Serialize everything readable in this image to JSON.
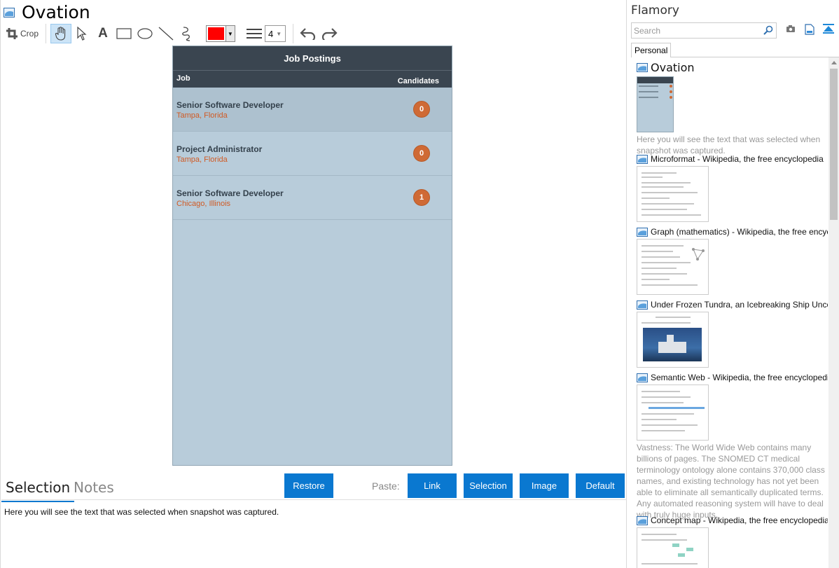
{
  "app": {
    "title": "Ovation"
  },
  "toolbar": {
    "crop_label": "Crop",
    "line_width": "4",
    "color": "#ff0000"
  },
  "snapshot": {
    "header": "Job Postings",
    "col_job": "Job",
    "col_candidates": "Candidates",
    "rows": [
      {
        "title": "Senior Software Developer",
        "location": "Tampa, Florida",
        "count": "0"
      },
      {
        "title": "Project Administrator",
        "location": "Tampa, Florida",
        "count": "0"
      },
      {
        "title": "Senior Software Developer",
        "location": "Chicago, Illinois",
        "count": "1"
      }
    ]
  },
  "bottom": {
    "tab_selection": "Selection",
    "tab_notes": "Notes",
    "restore": "Restore",
    "paste_label": "Paste:",
    "paste_link": "Link",
    "paste_selection": "Selection",
    "paste_image": "Image",
    "paste_default": "Default",
    "selection_text": "Here you will see the text that was selected when snapshot was captured."
  },
  "side": {
    "title": "Flamory",
    "search_placeholder": "Search",
    "tab": "Personal",
    "entries": [
      {
        "title": "Ovation",
        "desc": "Here you will see the text that was selected when snapshot was captured."
      },
      {
        "title": "Microformat - Wikipedia, the free encyclopedia"
      },
      {
        "title": "Graph (mathematics) - Wikipedia, the free encyclopedia"
      },
      {
        "title": "Under Frozen Tundra, an Icebreaking Ship Uncovers..."
      },
      {
        "title": "Semantic Web - Wikipedia, the free encyclopedia",
        "desc": "Vastness: The World Wide Web contains many billions of pages. The SNOMED CT medical terminology ontology alone contains 370,000 class names, and existing technology has not yet been able to eliminate all semantically duplicated terms. Any automated reasoning system will have to deal with truly huge inputs."
      },
      {
        "title": "Concept map - Wikipedia, the free encyclopedia"
      }
    ]
  },
  "colors": {
    "accent": "#0a78d0",
    "header_dark": "#3a4550",
    "badge": "#cf6a35",
    "location": "#d05a24"
  }
}
